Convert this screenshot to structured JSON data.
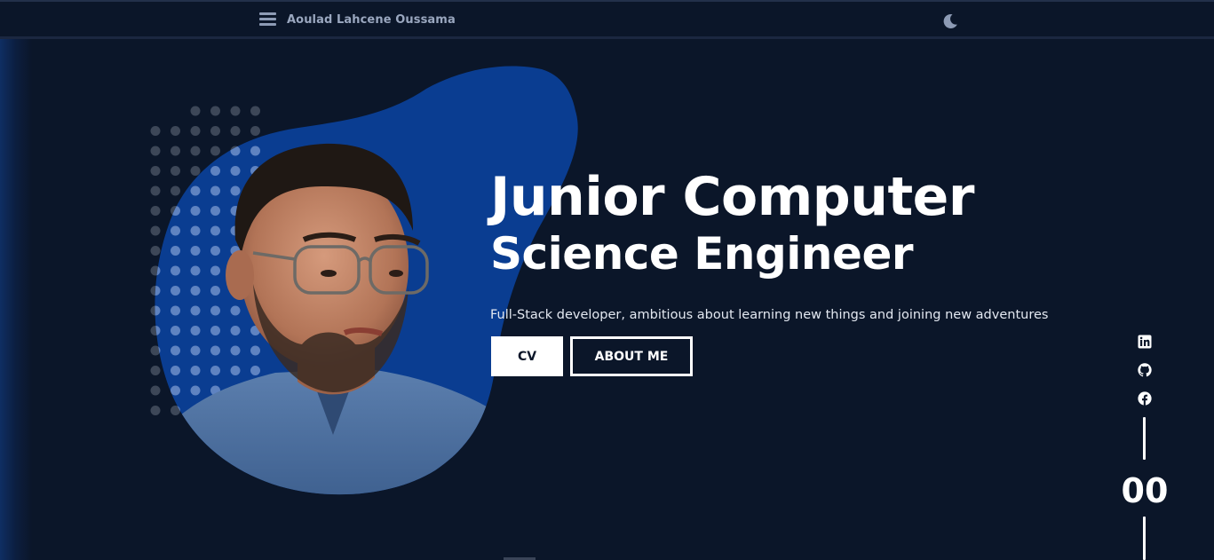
{
  "header": {
    "brand_name": "Aoulad Lahcene Oussama",
    "menu_icon": "hamburger-menu-icon",
    "theme_icon": "moon-icon"
  },
  "hero": {
    "title_line1": "Junior Computer",
    "title_line2": "Science Engineer",
    "tagline": "Full-Stack developer, ambitious about learning new things and joining new adventures",
    "cv_button": "CV",
    "about_button": "ABOUT ME",
    "portrait_icon": "profile-photo"
  },
  "social": {
    "items": [
      {
        "name": "linkedin",
        "icon": "linkedin-icon"
      },
      {
        "name": "github",
        "icon": "github-icon"
      },
      {
        "name": "facebook",
        "icon": "facebook-icon"
      }
    ],
    "counter": "00"
  },
  "colors": {
    "background": "#0b1629",
    "blob": "#0a3d91",
    "accent_text": "#ffffff",
    "nav_text": "#9aa7bf"
  }
}
